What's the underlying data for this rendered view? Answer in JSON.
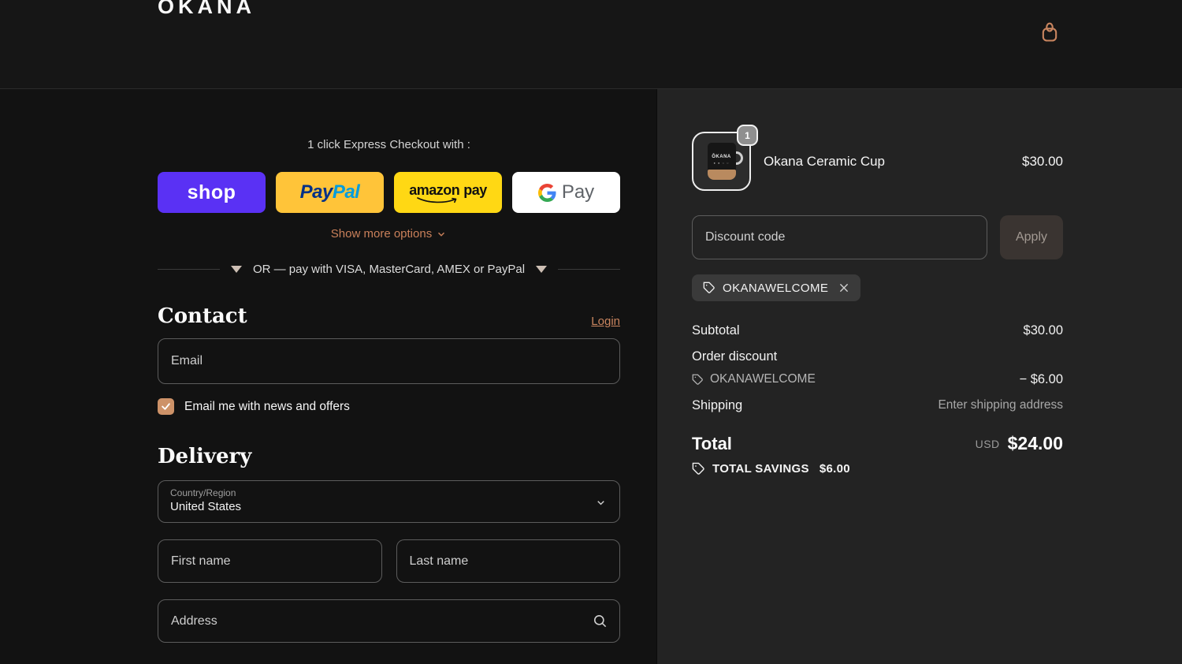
{
  "header": {
    "logo": "OKANA"
  },
  "express": {
    "caption": "1 click Express Checkout with :",
    "shop_label": "shop",
    "paypal_pay": "Pay",
    "paypal_pal": "Pal",
    "amazon_word": "amazon",
    "amazon_pay_word": "pay",
    "gpay_label": "Pay",
    "show_more_label": "Show more options",
    "or_text": "OR — pay with VISA, MasterCard, AMEX or PayPal"
  },
  "contact": {
    "heading": "Contact",
    "login_label": "Login",
    "email_placeholder": "Email",
    "newsletter_label": "Email me with news and offers",
    "newsletter_checked": true
  },
  "delivery": {
    "heading": "Delivery",
    "country_label": "Country/Region",
    "country_value": "United States",
    "first_name_placeholder": "First name",
    "last_name_placeholder": "Last name",
    "address_placeholder": "Address"
  },
  "order": {
    "item_name": "Okana Ceramic Cup",
    "item_qty": "1",
    "item_price": "$30.00",
    "item_brand_mark": "ŌKANA",
    "discount_placeholder": "Discount code",
    "apply_label": "Apply",
    "applied_code": "OKANAWELCOME",
    "subtotal_label": "Subtotal",
    "subtotal_value": "$30.00",
    "order_discount_label": "Order discount",
    "discount_code": "OKANAWELCOME",
    "discount_amount": "− $6.00",
    "shipping_label": "Shipping",
    "shipping_value": "Enter shipping address",
    "total_label": "Total",
    "currency": "USD",
    "total_value": "$24.00",
    "savings_label": "TOTAL SAVINGS",
    "savings_value": "$6.00"
  },
  "colors": {
    "accent_orange": "#c9855f",
    "shop_purple": "#5a31f4",
    "paypal_yellow": "#ffc439",
    "paypal_blue_dark": "#003087",
    "paypal_blue_light": "#009cde",
    "amazon_yellow": "#ffd814",
    "left_bg": "#121212",
    "right_bg": "#232323"
  }
}
